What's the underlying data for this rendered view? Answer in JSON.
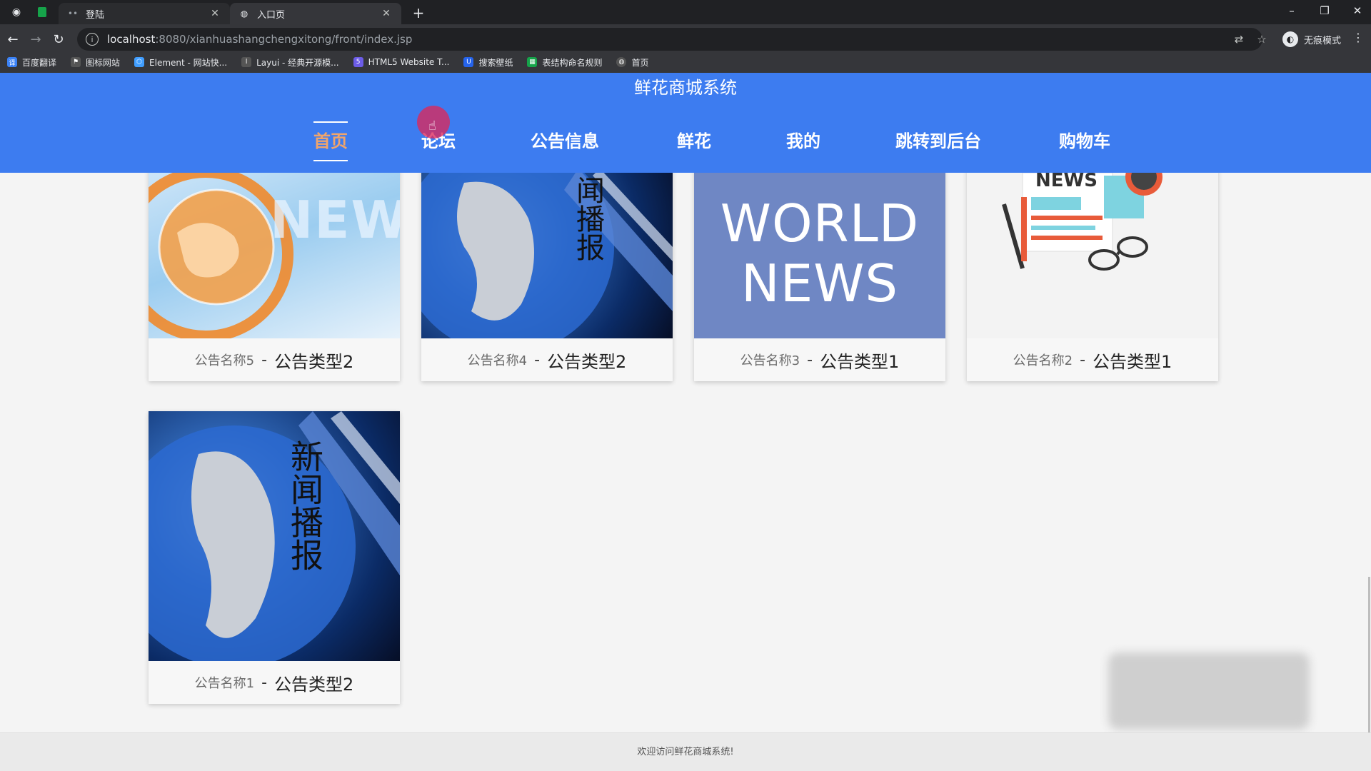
{
  "browser": {
    "tabs": [
      {
        "label": "登陆",
        "active": false
      },
      {
        "label": "入口页",
        "active": true
      }
    ],
    "url_host": "localhost",
    "url_path": ":8080/xianhuashangchengxitong/front/index.jsp",
    "profile_label": "无痕模式",
    "bookmarks": [
      {
        "label": "百度翻译",
        "color": "#3b82f6"
      },
      {
        "label": "图标网站",
        "color": "#555555"
      },
      {
        "label": "Element - 网站快...",
        "color": "#409eff"
      },
      {
        "label": "Layui - 经典开源模...",
        "color": "#555555"
      },
      {
        "label": "HTML5 Website T...",
        "color": "#6c5ce7"
      },
      {
        "label": "搜索壁纸",
        "color": "#2563eb"
      },
      {
        "label": "表结构命名规则",
        "color": "#16a34a"
      },
      {
        "label": "首页",
        "color": "#555555"
      }
    ]
  },
  "site": {
    "title": "鲜花商城系统",
    "nav": [
      {
        "label": "首页",
        "active": true
      },
      {
        "label": "论坛",
        "active": false
      },
      {
        "label": "公告信息",
        "active": false
      },
      {
        "label": "鲜花",
        "active": false
      },
      {
        "label": "我的",
        "active": false
      },
      {
        "label": "跳转到后台",
        "active": false
      },
      {
        "label": "购物车",
        "active": false
      }
    ]
  },
  "notices": [
    {
      "name": "公告名称5",
      "separator": "-",
      "type": "公告类型2",
      "image": "news-globe-orange"
    },
    {
      "name": "公告名称4",
      "separator": "-",
      "type": "公告类型2",
      "image": "news-broadcast-globe"
    },
    {
      "name": "公告名称3",
      "separator": "-",
      "type": "公告类型1",
      "image": "world-news"
    },
    {
      "name": "公告名称2",
      "separator": "-",
      "type": "公告类型1",
      "image": "newspaper-glasses"
    },
    {
      "name": "公告名称1",
      "separator": "-",
      "type": "公告类型2",
      "image": "news-broadcast-globe"
    }
  ],
  "thumb_text": {
    "news": "NEWS",
    "world": "WORLD",
    "news2": "NEWS",
    "paper": "NEWS",
    "broadcast_a": "闻播报",
    "broadcast_b": "新闻播报"
  },
  "footer": {
    "text": "欢迎访问鲜花商城系统!"
  }
}
